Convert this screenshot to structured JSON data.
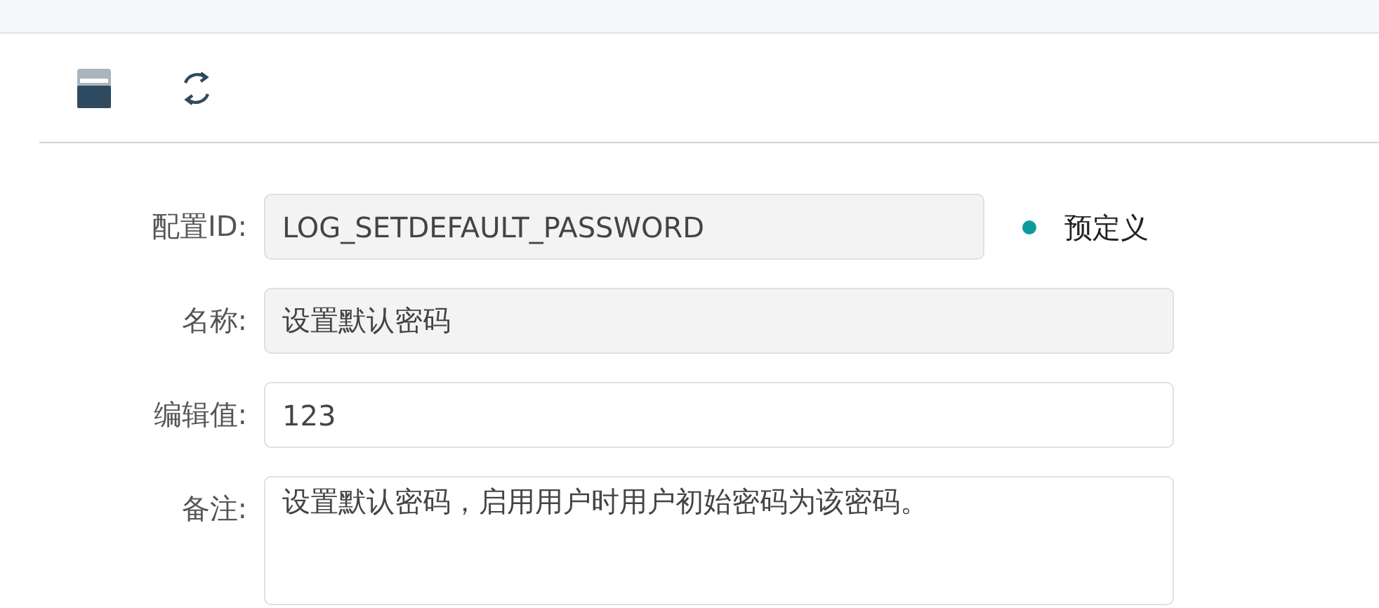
{
  "toolbar": {
    "buttons": [
      {
        "kind": "save"
      },
      {
        "kind": "refresh"
      }
    ]
  },
  "form": {
    "fields": [
      {
        "label": "配置ID:",
        "value": "LOG_SETDEFAULT_PASSWORD",
        "kind": "input",
        "disabled": true,
        "status": {
          "label": "预定义",
          "color": "#0e9a9a"
        }
      },
      {
        "label": "名称:",
        "value": "设置默认密码",
        "kind": "input",
        "disabled": true
      },
      {
        "label": "编辑值:",
        "value": "123",
        "kind": "input",
        "disabled": false
      },
      {
        "label": "备注:",
        "value": "设置默认密码，启用用户时用户初始密码为该密码。",
        "kind": "textarea",
        "disabled": false
      }
    ]
  }
}
